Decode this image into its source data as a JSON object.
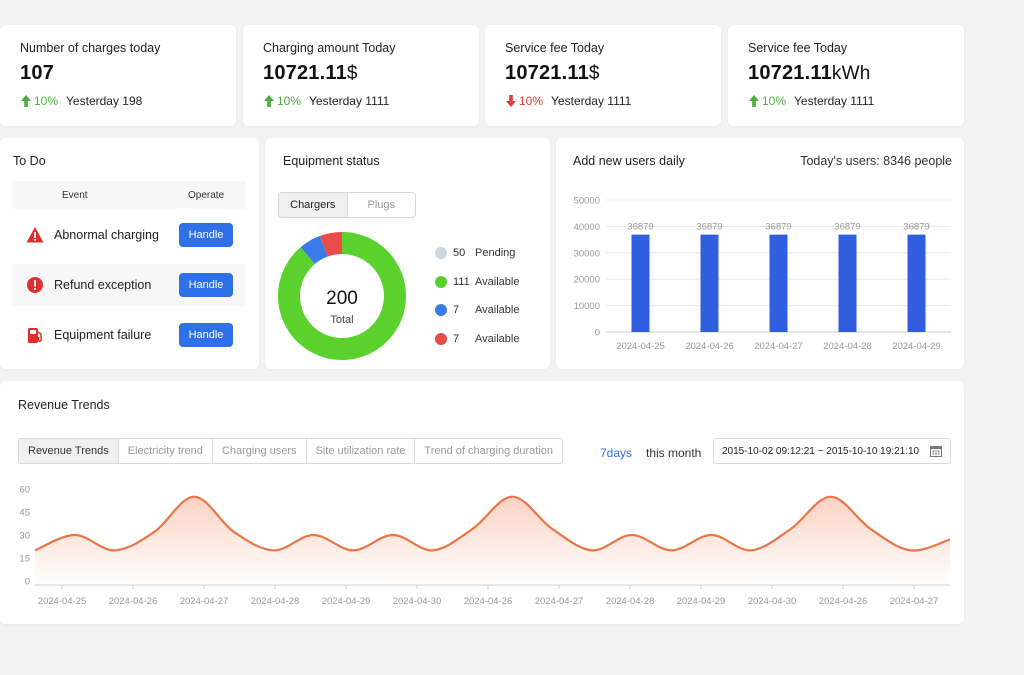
{
  "stats": [
    {
      "label": "Number of charges today",
      "value": "107",
      "unit": "",
      "trend": "up",
      "pct": "10%",
      "yesterday": "Yesterday 198"
    },
    {
      "label": "Charging amount Today",
      "value": "10721.11",
      "unit": "$",
      "trend": "up",
      "pct": "10%",
      "yesterday": "Yesterday 1111"
    },
    {
      "label": "Service fee Today",
      "value": "10721.11",
      "unit": "$",
      "trend": "down",
      "pct": "10%",
      "yesterday": "Yesterday 1111"
    },
    {
      "label": "Service fee Today",
      "value": "10721.11",
      "unit": "kWh",
      "trend": "up",
      "pct": "10%",
      "yesterday": "Yesterday 1111"
    }
  ],
  "colors": {
    "up": "#4caf3a",
    "down": "#e23b3b",
    "primary": "#2f6fe8",
    "bar": "#2f5fe0",
    "line": "#e8764a"
  },
  "todo": {
    "title": "To Do",
    "col_event": "Event",
    "col_operate": "Operate",
    "items": [
      {
        "icon": "warning-triangle-icon",
        "label": "Abnormal charging",
        "action": "Handle"
      },
      {
        "icon": "alert-circle-icon",
        "label": "Refund exception",
        "action": "Handle"
      },
      {
        "icon": "fuel-pump-icon",
        "label": "Equipment failure",
        "action": "Handle"
      }
    ]
  },
  "equipment": {
    "title": "Equipment status",
    "tabs": [
      "Chargers",
      "Plugs"
    ],
    "total_value": "200",
    "total_label": "Total",
    "legend": [
      {
        "count": "50",
        "label": "Pending",
        "color": "#cdd6e0"
      },
      {
        "count": "111",
        "label": "Available",
        "color": "#5bd12e"
      },
      {
        "count": "7",
        "label": "Available",
        "color": "#3b7be8"
      },
      {
        "count": "7",
        "label": "Available",
        "color": "#ea4b4b"
      }
    ]
  },
  "users": {
    "title": "Add new users daily",
    "today": "Today's users: 8346 people"
  },
  "revenue": {
    "title": "Revenue Trends",
    "tabs": [
      "Revenue Trends",
      "Electricity trend",
      "Charging users",
      "Site utilization rate",
      "Trend of charging duration"
    ],
    "range_7days": "7days",
    "range_month": "this month",
    "date_range": "2015-10-02 09:12:21 ~ 2015-10-10 19:21:10"
  },
  "chart_data": [
    {
      "type": "pie",
      "title": "",
      "categories": [
        "Available",
        "Available",
        "Available"
      ],
      "values": [
        111,
        7,
        7
      ],
      "donut": true,
      "center_text": "200"
    },
    {
      "type": "bar",
      "title": "",
      "categories": [
        "2024-04-25",
        "2024-04-26",
        "2024-04-27",
        "2024-04-28",
        "2024-04-29"
      ],
      "values": [
        36879,
        36879,
        36879,
        36879,
        36879
      ],
      "ylim": [
        0,
        50000
      ],
      "yticks": [
        0,
        10000,
        20000,
        30000,
        40000,
        50000
      ],
      "data_labels": true,
      "grid": true
    },
    {
      "type": "area",
      "title": "",
      "categories": [
        "2024-04-25",
        "2024-04-26",
        "2024-04-27",
        "2024-04-28",
        "2024-04-29",
        "2024-04-30",
        "2024-04-26",
        "2024-04-27",
        "2024-04-28",
        "2024-04-29",
        "2024-04-30",
        "2024-04-26",
        "2024-04-27"
      ],
      "values": [
        20,
        30,
        20,
        32,
        55,
        32,
        20,
        30,
        20,
        30,
        20,
        34,
        55,
        34,
        20,
        30,
        20,
        30,
        20,
        34,
        55,
        34,
        20,
        27
      ],
      "ylim": [
        0,
        60
      ],
      "yticks": [
        0,
        15,
        30,
        45,
        60
      ],
      "smooth": true
    }
  ]
}
